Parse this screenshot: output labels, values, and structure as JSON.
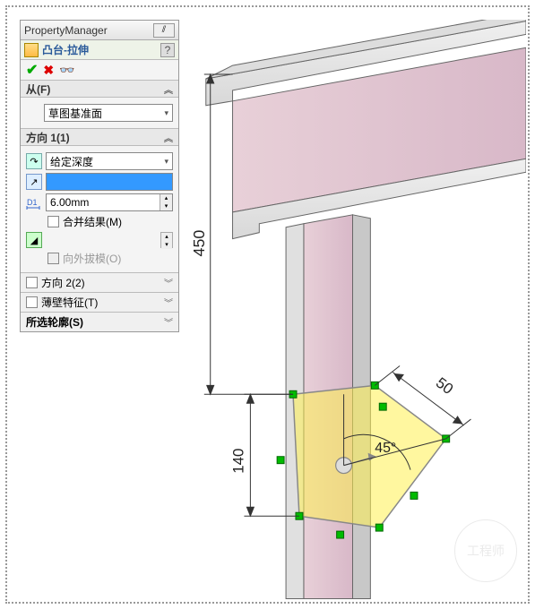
{
  "header": {
    "title": "PropertyManager"
  },
  "feature": {
    "name": "凸台-拉伸"
  },
  "from": {
    "label": "从(F)",
    "value": "草图基准面"
  },
  "dir1": {
    "label": "方向 1(1)",
    "end_condition": "给定深度",
    "depth_value": "",
    "distance_value": "6.00mm",
    "merge_label": "合并结果(M)",
    "draft_label": "向外拔模(O)"
  },
  "dir2": {
    "label": "方向 2(2)"
  },
  "thin": {
    "label": "薄壁特征(T)"
  },
  "contours": {
    "label": "所选轮廓(S)"
  },
  "dims": {
    "v450": "450",
    "v140": "140",
    "v50": "50",
    "angle": "45°"
  },
  "watermark": "工程师"
}
